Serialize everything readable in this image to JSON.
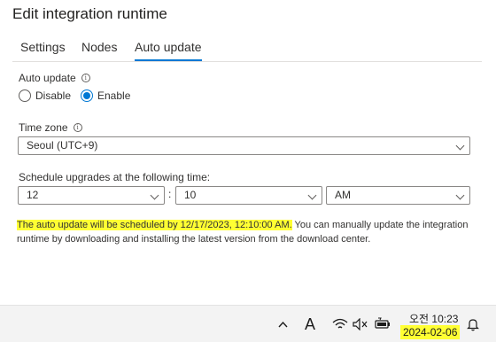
{
  "dialog": {
    "title": "Edit integration runtime"
  },
  "tabs": [
    {
      "label": "Settings"
    },
    {
      "label": "Nodes"
    },
    {
      "label": "Auto update"
    }
  ],
  "auto_update": {
    "label": "Auto update",
    "options": [
      {
        "label": "Disable",
        "selected": false
      },
      {
        "label": "Enable",
        "selected": true
      }
    ]
  },
  "time_zone": {
    "label": "Time zone",
    "value": "Seoul (UTC+9)"
  },
  "schedule": {
    "label": "Schedule upgrades at the following time:",
    "hour": "12",
    "separator": ":",
    "minute": "10",
    "period": "AM"
  },
  "message": {
    "highlighted": "The auto update will be scheduled by 12/17/2023, 12:10:00 AM.",
    "rest": " You can manually update the integration runtime by downloading and installing the latest version from the download center."
  },
  "taskbar": {
    "font_glyph": "A",
    "time": "오전 10:23",
    "date": "2024-02-06",
    "icons": [
      "chevron-up-icon",
      "font-icon",
      "wifi-icon",
      "speaker-muted-icon",
      "battery-icon",
      "bell-icon"
    ]
  },
  "colors": {
    "accent": "#0078d4",
    "highlight": "#ffff33"
  }
}
